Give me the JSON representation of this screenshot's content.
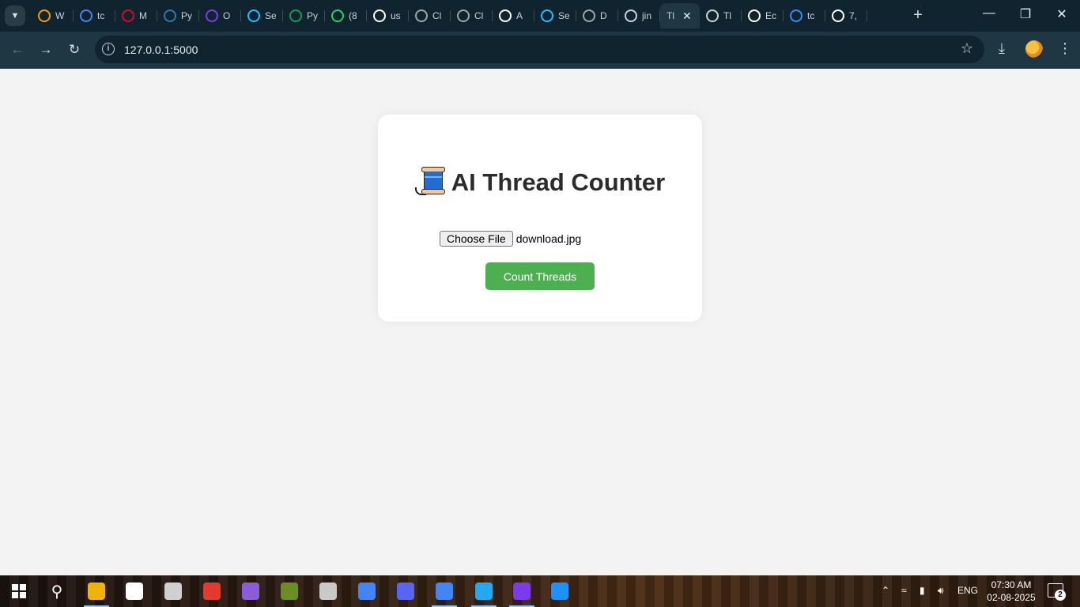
{
  "browser": {
    "tabs": [
      {
        "title": "W",
        "icon": "infinity-icon",
        "color": "#f59c00"
      },
      {
        "title": "tc",
        "icon": "google-icon",
        "color": "#4285f4"
      },
      {
        "title": "M",
        "icon": "pinterest-icon",
        "color": "#e60023"
      },
      {
        "title": "Py",
        "icon": "python-icon",
        "color": "#3776ab"
      },
      {
        "title": "O",
        "icon": "p-logo-icon",
        "color": "#7b3fe4"
      },
      {
        "title": "Se",
        "icon": "kaggle-k-icon",
        "color": "#20beff"
      },
      {
        "title": "Py",
        "icon": "w-logo-icon",
        "color": "#0f9d58"
      },
      {
        "title": "(8",
        "icon": "whatsapp-icon",
        "color": "#25d366"
      },
      {
        "title": "us",
        "icon": "github-icon",
        "color": "#ffffff"
      },
      {
        "title": "Cl",
        "icon": "globe-icon",
        "color": "#9aa7ad"
      },
      {
        "title": "Cl",
        "icon": "globe-icon",
        "color": "#9aa7ad"
      },
      {
        "title": "A",
        "icon": "api-logo-icon",
        "color": "#ffffff"
      },
      {
        "title": "Se",
        "icon": "kaggle-k-icon",
        "color": "#20beff"
      },
      {
        "title": "D",
        "icon": "globe-icon",
        "color": "#9aa7ad"
      },
      {
        "title": "jin",
        "icon": "terminal-icon",
        "color": "#c9d3d8"
      },
      {
        "title": "Tl",
        "icon": "none",
        "color": "#1f3743",
        "active": true
      },
      {
        "title": "Tl",
        "icon": "openai-icon",
        "color": "#c9d3d8"
      },
      {
        "title": "Ec",
        "icon": "github-icon",
        "color": "#ffffff"
      },
      {
        "title": "tc",
        "icon": "google-icon",
        "color": "#4285f4"
      },
      {
        "title": "7,",
        "icon": "is-logo-icon",
        "color": "#ffffff"
      }
    ],
    "url": "127.0.0.1:5000"
  },
  "app": {
    "title": "AI Thread Counter",
    "choose_file_label": "Choose File",
    "file_name": "download.jpg",
    "count_button_label": "Count Threads",
    "accent": "#4caf50"
  },
  "taskbar": {
    "apps": [
      {
        "name": "file-explorer-icon",
        "color": "#f0b400",
        "active": true
      },
      {
        "name": "capcut-icon",
        "color": "#ffffff"
      },
      {
        "name": "roblox-icon",
        "color": "#d0d0d0"
      },
      {
        "name": "red-app-icon",
        "color": "#e23b2e"
      },
      {
        "name": "network-app-icon",
        "color": "#8a5cd6"
      },
      {
        "name": "minecraft-icon",
        "color": "#6b8e23"
      },
      {
        "name": "obs-icon",
        "color": "#c9c9c9"
      },
      {
        "name": "chrome-icon",
        "color": "#4285f4"
      },
      {
        "name": "discord-icon",
        "color": "#5865f2"
      },
      {
        "name": "chrome-profile-icon",
        "color": "#4285f4",
        "active": true
      },
      {
        "name": "vscode-icon",
        "color": "#23a9f2",
        "active": true
      },
      {
        "name": "winrar-icon",
        "color": "#7c3aed",
        "active": true
      },
      {
        "name": "photos-icon",
        "color": "#1e90ff"
      }
    ],
    "language": "ENG",
    "time": "07:30 AM",
    "date": "02-08-2025",
    "notifications": "2"
  }
}
